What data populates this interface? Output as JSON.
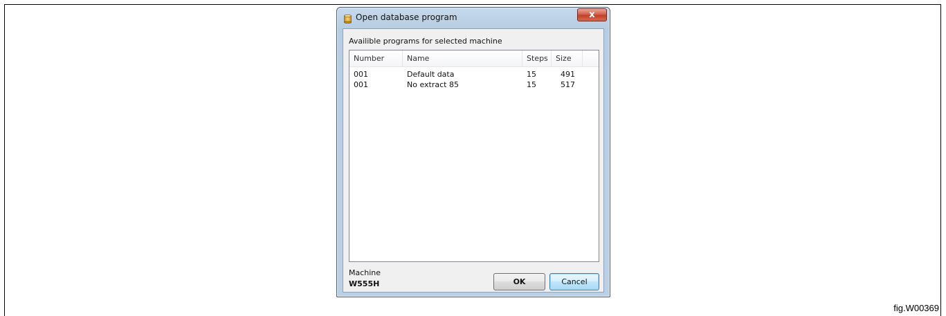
{
  "dialog": {
    "title": "Open database program",
    "close_glyph": "x",
    "section_label": "Availible programs for selected machine",
    "columns": [
      "Number",
      "Name",
      "Steps",
      "Size"
    ],
    "rows": [
      {
        "number": "001",
        "name": "Default data",
        "steps": "15",
        "size": "491"
      },
      {
        "number": "001",
        "name": "No extract 85",
        "steps": "15",
        "size": "517"
      }
    ],
    "machine_label": "Machine",
    "machine_value": "W555H",
    "ok_label": "OK",
    "cancel_label": "Cancel",
    "icons": {
      "title_icon": "database-cylinder-icon",
      "close_icon": "close-icon"
    },
    "colors": {
      "close_button": "#c9452d",
      "window_frame": "#bcd0e5"
    }
  },
  "figure": {
    "caption": "fig.W00369"
  }
}
